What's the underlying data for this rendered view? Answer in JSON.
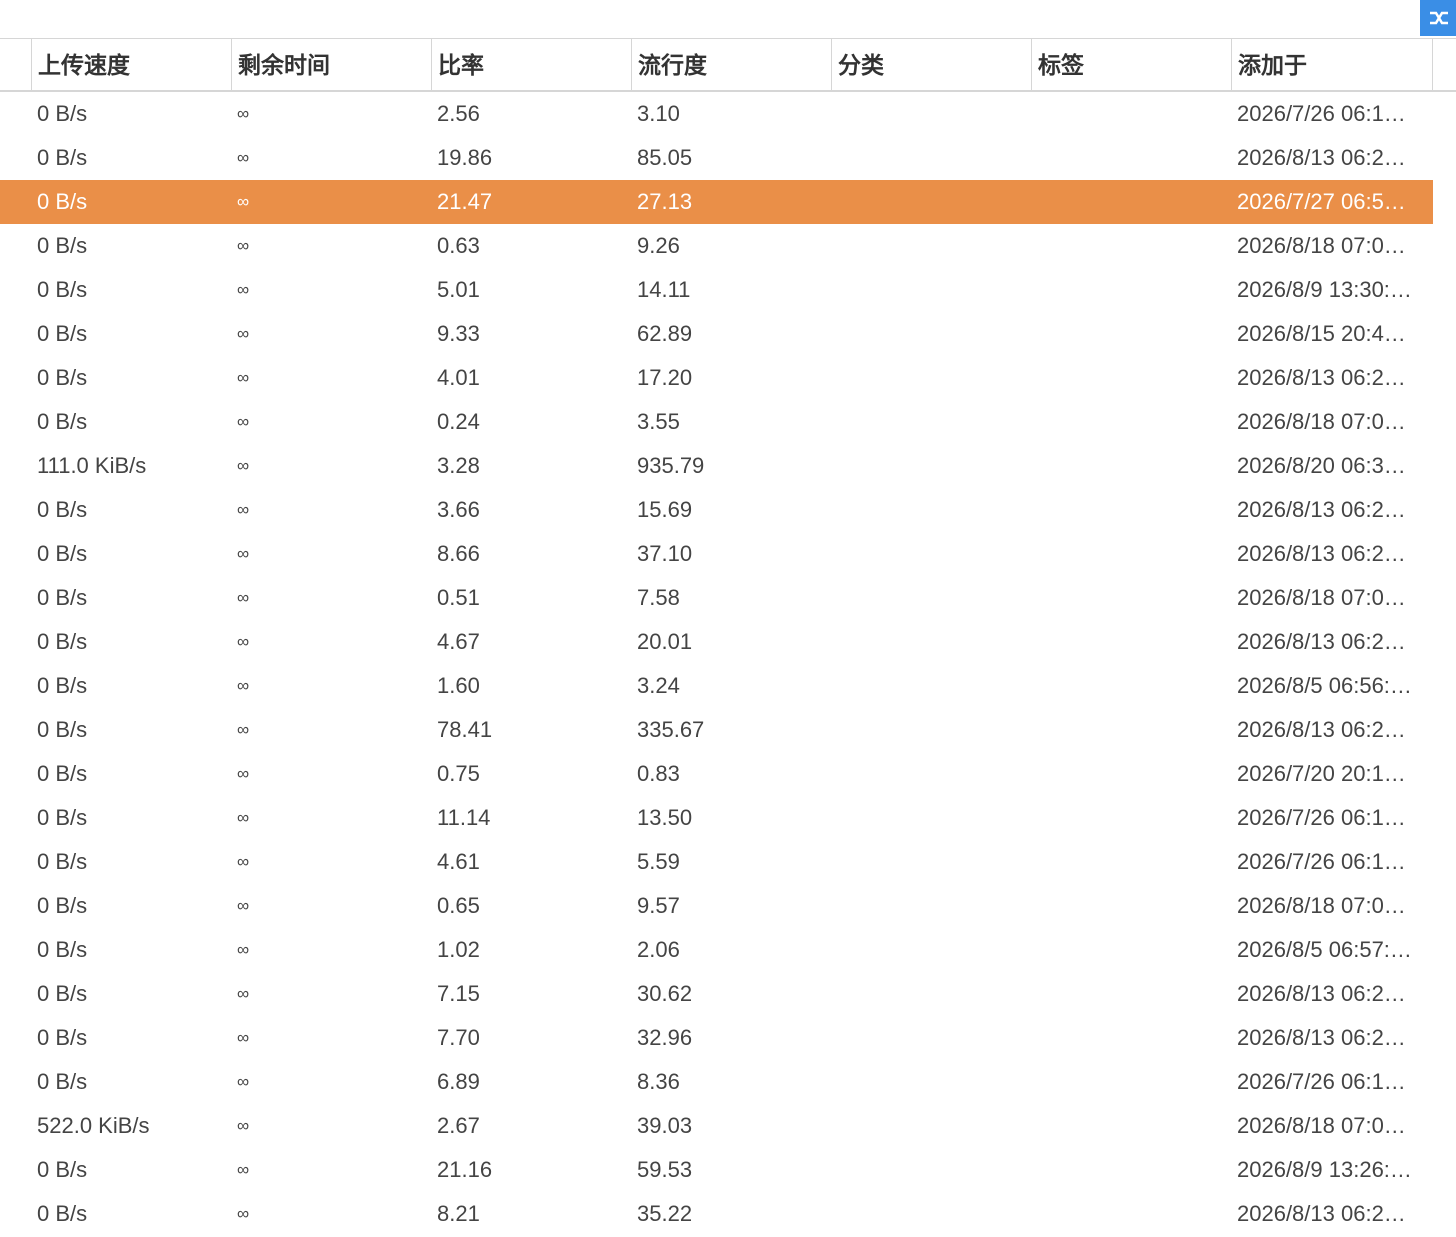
{
  "toolbar": {
    "corner_icon": "shuffle-icon",
    "accent": "#3a8ee6"
  },
  "selected_row": 2,
  "selected_color": "#ea8f48",
  "columns": [
    "上传速度",
    "剩余时间",
    "比率",
    "流行度",
    "分类",
    "标签",
    "添加于"
  ],
  "rows": [
    [
      "0 B/s",
      "∞",
      "2.56",
      "3.10",
      "",
      "",
      "2026/7/26 06:1…"
    ],
    [
      "0 B/s",
      "∞",
      "19.86",
      "85.05",
      "",
      "",
      "2026/8/13 06:2…"
    ],
    [
      "0 B/s",
      "∞",
      "21.47",
      "27.13",
      "",
      "",
      "2026/7/27 06:5…"
    ],
    [
      "0 B/s",
      "∞",
      "0.63",
      "9.26",
      "",
      "",
      "2026/8/18 07:0…"
    ],
    [
      "0 B/s",
      "∞",
      "5.01",
      "14.11",
      "",
      "",
      "2026/8/9 13:30:…"
    ],
    [
      "0 B/s",
      "∞",
      "9.33",
      "62.89",
      "",
      "",
      "2026/8/15 20:4…"
    ],
    [
      "0 B/s",
      "∞",
      "4.01",
      "17.20",
      "",
      "",
      "2026/8/13 06:2…"
    ],
    [
      "0 B/s",
      "∞",
      "0.24",
      "3.55",
      "",
      "",
      "2026/8/18 07:0…"
    ],
    [
      "111.0 KiB/s",
      "∞",
      "3.28",
      "935.79",
      "",
      "",
      "2026/8/20 06:3…"
    ],
    [
      "0 B/s",
      "∞",
      "3.66",
      "15.69",
      "",
      "",
      "2026/8/13 06:2…"
    ],
    [
      "0 B/s",
      "∞",
      "8.66",
      "37.10",
      "",
      "",
      "2026/8/13 06:2…"
    ],
    [
      "0 B/s",
      "∞",
      "0.51",
      "7.58",
      "",
      "",
      "2026/8/18 07:0…"
    ],
    [
      "0 B/s",
      "∞",
      "4.67",
      "20.01",
      "",
      "",
      "2026/8/13 06:2…"
    ],
    [
      "0 B/s",
      "∞",
      "1.60",
      "3.24",
      "",
      "",
      "2026/8/5 06:56:…"
    ],
    [
      "0 B/s",
      "∞",
      "78.41",
      "335.67",
      "",
      "",
      "2026/8/13 06:2…"
    ],
    [
      "0 B/s",
      "∞",
      "0.75",
      "0.83",
      "",
      "",
      "2026/7/20 20:1…"
    ],
    [
      "0 B/s",
      "∞",
      "11.14",
      "13.50",
      "",
      "",
      "2026/7/26 06:1…"
    ],
    [
      "0 B/s",
      "∞",
      "4.61",
      "5.59",
      "",
      "",
      "2026/7/26 06:1…"
    ],
    [
      "0 B/s",
      "∞",
      "0.65",
      "9.57",
      "",
      "",
      "2026/8/18 07:0…"
    ],
    [
      "0 B/s",
      "∞",
      "1.02",
      "2.06",
      "",
      "",
      "2026/8/5 06:57:…"
    ],
    [
      "0 B/s",
      "∞",
      "7.15",
      "30.62",
      "",
      "",
      "2026/8/13 06:2…"
    ],
    [
      "0 B/s",
      "∞",
      "7.70",
      "32.96",
      "",
      "",
      "2026/8/13 06:2…"
    ],
    [
      "0 B/s",
      "∞",
      "6.89",
      "8.36",
      "",
      "",
      "2026/7/26 06:1…"
    ],
    [
      "522.0 KiB/s",
      "∞",
      "2.67",
      "39.03",
      "",
      "",
      "2026/8/18 07:0…"
    ],
    [
      "0 B/s",
      "∞",
      "21.16",
      "59.53",
      "",
      "",
      "2026/8/9 13:26:…"
    ],
    [
      "0 B/s",
      "∞",
      "8.21",
      "35.22",
      "",
      "",
      "2026/8/13 06:2…"
    ]
  ]
}
